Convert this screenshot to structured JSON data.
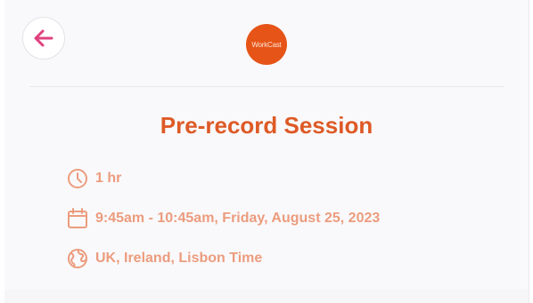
{
  "colors": {
    "accent": "#de5a26",
    "detail_text": "#ec9c7e",
    "back_arrow": "#e0417e",
    "logo_bg": "#e65417"
  },
  "header": {
    "back_icon": "arrow-left-icon",
    "logo_text": "WorkCast"
  },
  "event": {
    "title": "Pre-record Session",
    "duration": "1 hr",
    "datetime": "9:45am - 10:45am, Friday, August 25, 2023",
    "timezone": "UK, Ireland, Lisbon Time",
    "icons": {
      "duration": "clock-icon",
      "datetime": "calendar-icon",
      "timezone": "globe-icon"
    }
  }
}
